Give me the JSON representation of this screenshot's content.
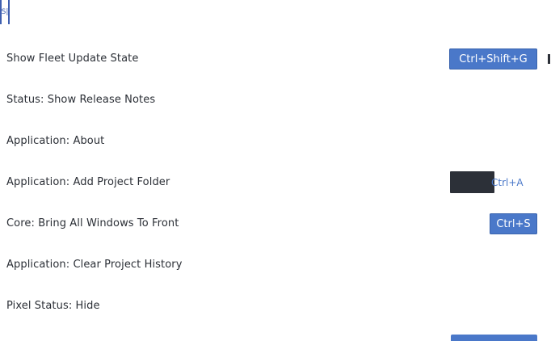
{
  "top_marker": {
    "glyph": "S|"
  },
  "commands": [
    {
      "label": "Show Fleet Update State",
      "shortcut": "Ctrl+Shift+G"
    },
    {
      "label": "Status: Show Release Notes",
      "shortcut": ""
    },
    {
      "label": "Application: About",
      "shortcut": ""
    },
    {
      "label": "Application: Add Project Folder",
      "shortcut": "Ctrl+A"
    },
    {
      "label": "Core: Bring All Windows To Front",
      "shortcut": "Ctrl+S"
    },
    {
      "label": "Application: Clear Project History",
      "shortcut": ""
    },
    {
      "label": "Pixel Status: Hide",
      "shortcut": ""
    }
  ],
  "colors": {
    "accent": "#4a78c9",
    "text": "#2b2f36",
    "dark": "#2c3038"
  }
}
